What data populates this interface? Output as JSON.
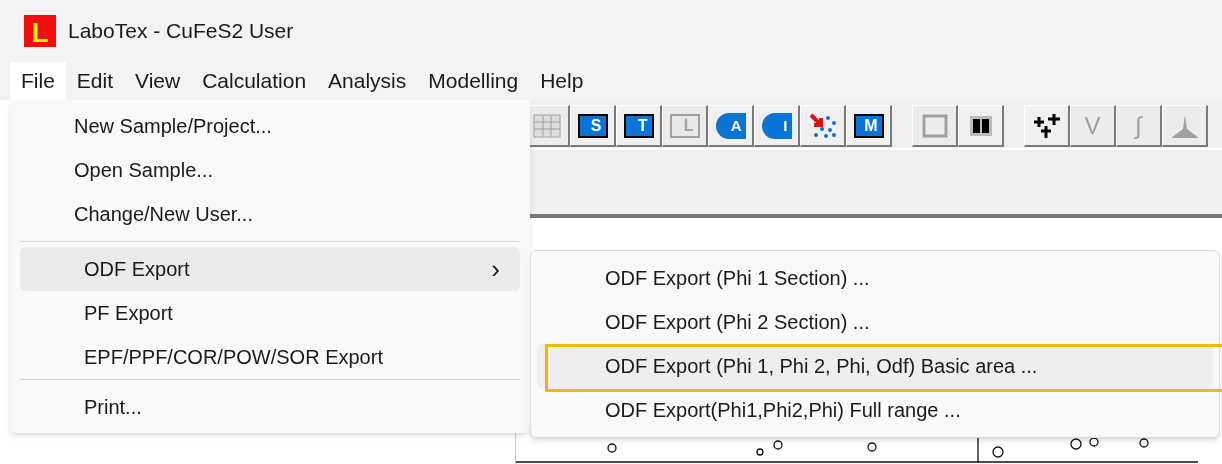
{
  "window": {
    "title": "LaboTex - CuFeS2 User",
    "logo_letter": "L"
  },
  "menu_bar": [
    {
      "label": "File",
      "selected": true
    },
    {
      "label": "Edit",
      "selected": false
    },
    {
      "label": "View",
      "selected": false
    },
    {
      "label": "Calculation",
      "selected": false
    },
    {
      "label": "Analysis",
      "selected": false
    },
    {
      "label": "Modelling",
      "selected": false
    },
    {
      "label": "Help",
      "selected": false
    }
  ],
  "toolbar": {
    "groups": [
      [
        {
          "kind": "grid",
          "disabled": true
        },
        {
          "kind": "table",
          "glyph": "S",
          "disabled": false
        },
        {
          "kind": "table",
          "glyph": "T",
          "disabled": false
        },
        {
          "kind": "table",
          "glyph": "L",
          "disabled": true
        },
        {
          "kind": "pole",
          "glyph": "A",
          "disabled": false
        },
        {
          "kind": "pole",
          "glyph": "I",
          "disabled": false
        },
        {
          "kind": "scatter",
          "disabled": false
        },
        {
          "kind": "table",
          "glyph": "M",
          "disabled": false
        }
      ],
      [
        {
          "kind": "frame",
          "disabled": true
        },
        {
          "kind": "split",
          "disabled": false
        }
      ],
      [
        {
          "kind": "cross",
          "disabled": false
        },
        {
          "kind": "letter",
          "glyph": "V",
          "disabled": true
        },
        {
          "kind": "letter",
          "glyph": "∫",
          "disabled": true
        },
        {
          "kind": "peak",
          "disabled": true
        }
      ]
    ]
  },
  "file_menu": {
    "sections": [
      [
        {
          "label": "New Sample/Project...",
          "selected": false
        },
        {
          "label": "Open Sample...",
          "selected": false
        },
        {
          "label": "Change/New User...",
          "selected": false
        }
      ],
      [
        {
          "label": "ODF Export",
          "selected": true,
          "submenu_arrow": "›"
        },
        {
          "label": "PF Export",
          "selected": false
        },
        {
          "label": "EPF/PPF/COR/POW/SOR Export",
          "selected": false
        }
      ],
      [
        {
          "label": "Print...",
          "selected": false
        }
      ]
    ]
  },
  "submenu": [
    {
      "label": "ODF Export (Phi 1 Section) ...",
      "selected": false,
      "highlighted": false
    },
    {
      "label": "ODF Export  (Phi 2 Section) ...",
      "selected": false,
      "highlighted": false
    },
    {
      "label": "ODF Export (Phi 1, Phi 2, Phi, Odf) Basic area  ...",
      "selected": true,
      "highlighted": true
    },
    {
      "label": "ODF Export(Phi1,Phi2,Phi) Full range ...",
      "selected": false,
      "highlighted": false
    }
  ]
}
